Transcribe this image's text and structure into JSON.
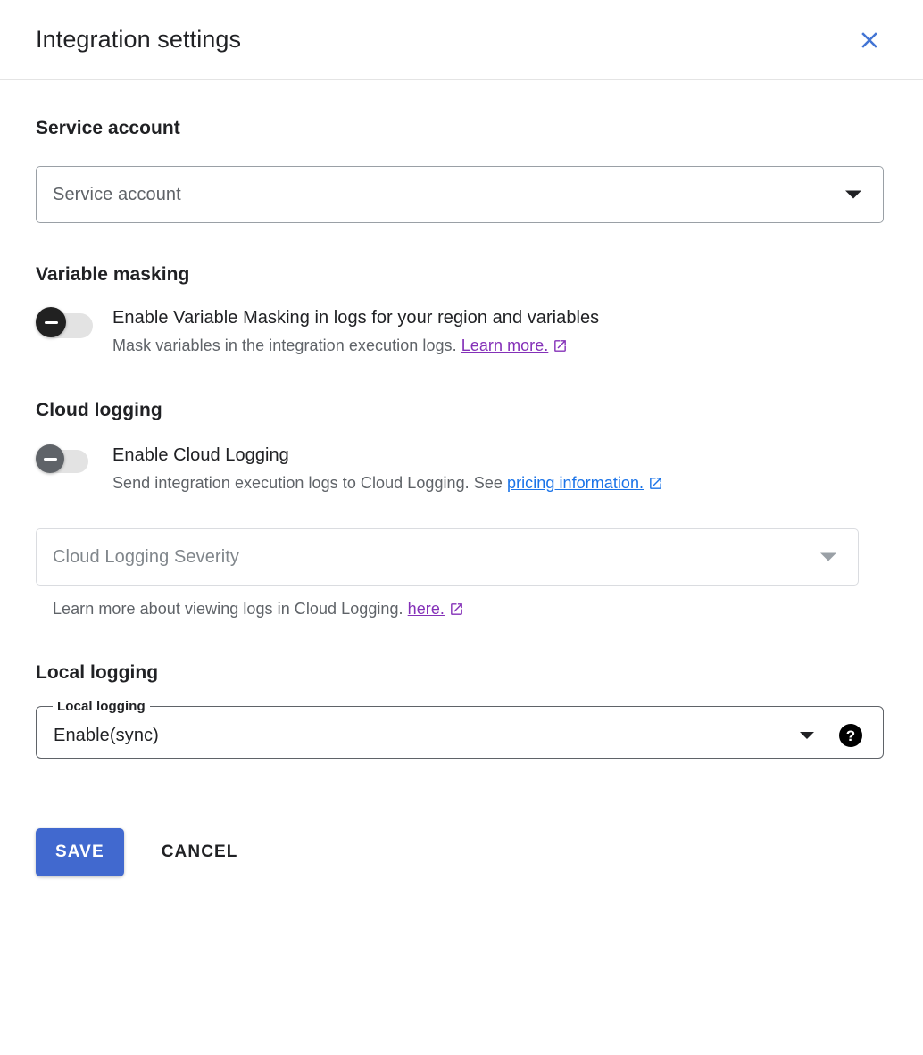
{
  "dialog": {
    "title": "Integration settings",
    "close_icon": "close-icon"
  },
  "service_account": {
    "heading": "Service account",
    "select_placeholder": "Service account",
    "caret_icon": "chevron-down-icon"
  },
  "variable_masking": {
    "heading": "Variable masking",
    "toggle_label": "Enable Variable Masking in logs for your region and variables",
    "toggle_state": "off",
    "desc_prefix": "Mask variables in the integration execution logs.",
    "link_text": "Learn more.",
    "link_color": "#8430b8",
    "ext_icon": "open-in-new-icon"
  },
  "cloud_logging": {
    "heading": "Cloud logging",
    "toggle_label": "Enable Cloud Logging",
    "toggle_state": "off",
    "desc_prefix": "Send integration execution logs to Cloud Logging. See",
    "link_text": "pricing information.",
    "link_color": "#1a73e8",
    "ext_icon": "open-in-new-icon",
    "severity_placeholder": "Cloud Logging Severity",
    "severity_disabled": true,
    "helper_prefix": "Learn more about viewing logs in Cloud Logging.",
    "helper_link_text": "here.",
    "helper_link_color": "#8430b8"
  },
  "local_logging": {
    "heading": "Local logging",
    "field_label": "Local logging",
    "field_value": "Enable(sync)",
    "caret_icon": "chevron-down-icon",
    "help_icon": "help-icon",
    "help_glyph": "?"
  },
  "footer": {
    "save_label": "SAVE",
    "cancel_label": "CANCEL",
    "save_color": "#4169cf"
  }
}
